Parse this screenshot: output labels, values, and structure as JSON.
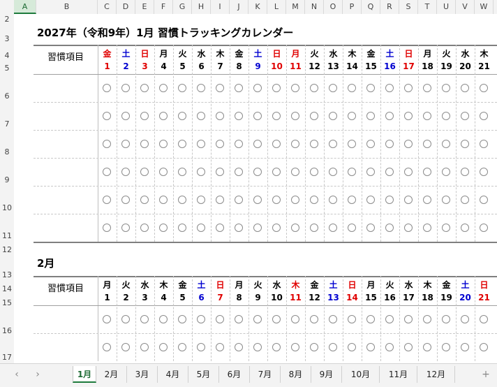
{
  "columns": [
    "A",
    "B",
    "C",
    "D",
    "E",
    "F",
    "G",
    "H",
    "I",
    "J",
    "K",
    "L",
    "M",
    "N",
    "O",
    "P",
    "Q",
    "R",
    "S",
    "T",
    "U",
    "V",
    "W"
  ],
  "selected_column": "A",
  "rows": [
    "2",
    "3",
    "4",
    "5",
    "6",
    "7",
    "8",
    "9",
    "10",
    "11",
    "12",
    "13",
    "14",
    "15",
    "16",
    "17"
  ],
  "january": {
    "title": "2027年（令和9年）1月 習慣トラッキングカレンダー",
    "habit_header": "習慣項目",
    "days": [
      {
        "w": "金",
        "d": "1",
        "c": "#e00000"
      },
      {
        "w": "土",
        "d": "2",
        "c": "#0000d0"
      },
      {
        "w": "日",
        "d": "3",
        "c": "#e00000"
      },
      {
        "w": "月",
        "d": "4",
        "c": "#000000"
      },
      {
        "w": "火",
        "d": "5",
        "c": "#000000"
      },
      {
        "w": "水",
        "d": "6",
        "c": "#000000"
      },
      {
        "w": "木",
        "d": "7",
        "c": "#000000"
      },
      {
        "w": "金",
        "d": "8",
        "c": "#000000"
      },
      {
        "w": "土",
        "d": "9",
        "c": "#0000d0"
      },
      {
        "w": "日",
        "d": "10",
        "c": "#e00000"
      },
      {
        "w": "月",
        "d": "11",
        "c": "#e00000"
      },
      {
        "w": "火",
        "d": "12",
        "c": "#000000"
      },
      {
        "w": "水",
        "d": "13",
        "c": "#000000"
      },
      {
        "w": "木",
        "d": "14",
        "c": "#000000"
      },
      {
        "w": "金",
        "d": "15",
        "c": "#000000"
      },
      {
        "w": "土",
        "d": "16",
        "c": "#0000d0"
      },
      {
        "w": "日",
        "d": "17",
        "c": "#e00000"
      },
      {
        "w": "月",
        "d": "18",
        "c": "#000000"
      },
      {
        "w": "火",
        "d": "19",
        "c": "#000000"
      },
      {
        "w": "水",
        "d": "20",
        "c": "#000000"
      },
      {
        "w": "木",
        "d": "21",
        "c": "#000000"
      }
    ]
  },
  "february": {
    "title": "2月",
    "habit_header": "習慣項目",
    "days": [
      {
        "w": "月",
        "d": "1",
        "c": "#000000"
      },
      {
        "w": "火",
        "d": "2",
        "c": "#000000"
      },
      {
        "w": "水",
        "d": "3",
        "c": "#000000"
      },
      {
        "w": "木",
        "d": "4",
        "c": "#000000"
      },
      {
        "w": "金",
        "d": "5",
        "c": "#000000"
      },
      {
        "w": "土",
        "d": "6",
        "c": "#0000d0"
      },
      {
        "w": "日",
        "d": "7",
        "c": "#e00000"
      },
      {
        "w": "月",
        "d": "8",
        "c": "#000000"
      },
      {
        "w": "火",
        "d": "9",
        "c": "#000000"
      },
      {
        "w": "水",
        "d": "10",
        "c": "#000000"
      },
      {
        "w": "木",
        "d": "11",
        "c": "#e00000"
      },
      {
        "w": "金",
        "d": "12",
        "c": "#000000"
      },
      {
        "w": "土",
        "d": "13",
        "c": "#0000d0"
      },
      {
        "w": "日",
        "d": "14",
        "c": "#e00000"
      },
      {
        "w": "月",
        "d": "15",
        "c": "#000000"
      },
      {
        "w": "火",
        "d": "16",
        "c": "#000000"
      },
      {
        "w": "水",
        "d": "17",
        "c": "#000000"
      },
      {
        "w": "木",
        "d": "18",
        "c": "#000000"
      },
      {
        "w": "金",
        "d": "19",
        "c": "#000000"
      },
      {
        "w": "土",
        "d": "20",
        "c": "#0000d0"
      },
      {
        "w": "日",
        "d": "21",
        "c": "#e00000"
      }
    ]
  },
  "sheet_tabs": [
    "1月",
    "2月",
    "3月",
    "4月",
    "5月",
    "6月",
    "7月",
    "8月",
    "9月",
    "10月",
    "11月",
    "12月"
  ],
  "active_tab": "1月",
  "nav": {
    "prev": "‹",
    "next": "›",
    "add": "+"
  },
  "icons": {
    "circle": "habit-circle-icon"
  }
}
